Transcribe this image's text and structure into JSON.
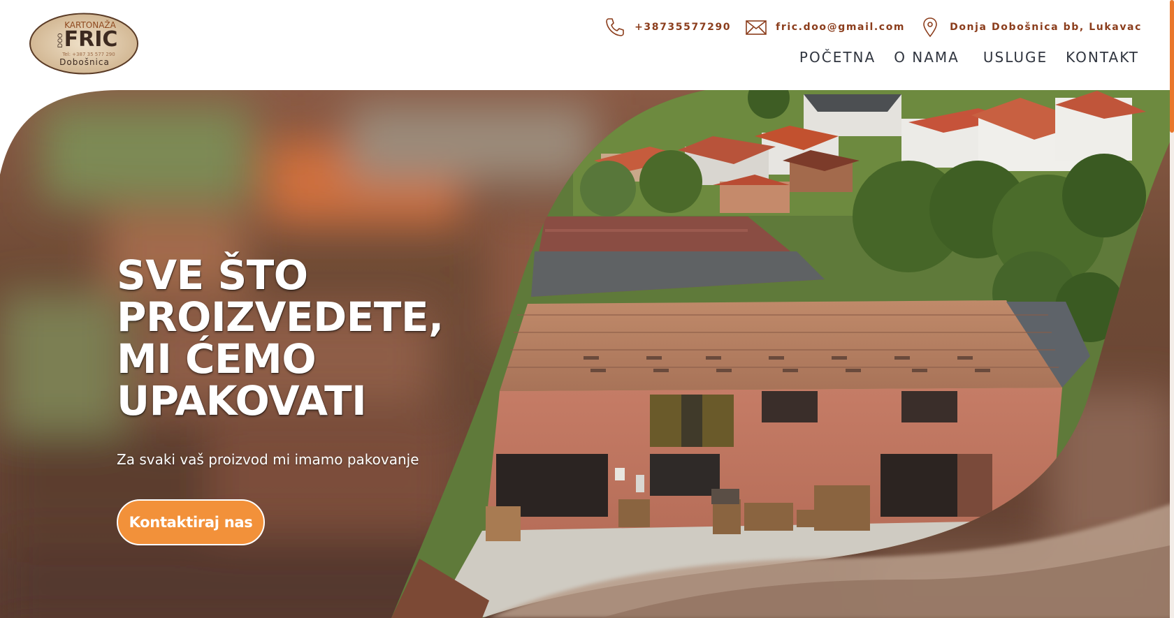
{
  "brand": {
    "top_text": "KARTONAŽA",
    "name": "FRIC",
    "suffix": "DOO",
    "phone_small": "Tel: +387 35 577 290",
    "location": "Dobošnica"
  },
  "contact": {
    "phone": "+38735577290",
    "email": "fric.doo@gmail.com",
    "address": "Donja Dobošnica bb, Lukavac"
  },
  "nav": {
    "items": [
      {
        "label": "POČETNA"
      },
      {
        "label": "O NAMA"
      },
      {
        "label": "USLUGE"
      },
      {
        "label": "KONTAKT"
      }
    ]
  },
  "hero": {
    "title_lines": [
      "SVE ŠTO",
      "PROIZVEDETE,",
      "MI ĆEMO",
      "UPAKOVATI"
    ],
    "subtitle": "Za svaki vaš proizvod mi imamo pakovanje",
    "cta_label": "Kontaktiraj nas"
  },
  "colors": {
    "accent": "#f2913a",
    "brand_brown": "#8b3d1c",
    "nav_text": "#30353f"
  },
  "icons": {
    "phone": "phone-icon",
    "email": "envelope-icon",
    "address": "map-pin-icon"
  }
}
